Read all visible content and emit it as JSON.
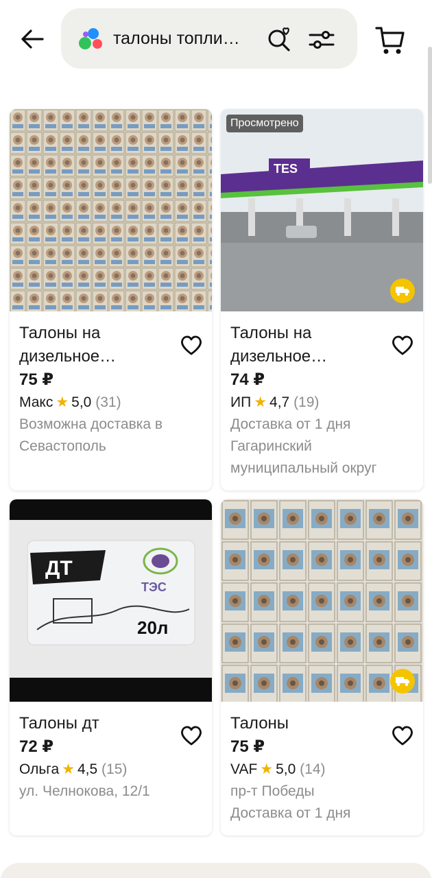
{
  "header": {
    "search_query": "талоны топли…",
    "icons": [
      "back-arrow-icon",
      "app-logo",
      "favorite-search-icon",
      "filters-icon",
      "cart-icon"
    ]
  },
  "colors": {
    "star": "#f2b200",
    "delivery_badge": "#f5c400",
    "muted_text": "#8c8c8c",
    "search_bg": "#efefec"
  },
  "cards": [
    {
      "title": "Талоны на дизельное…",
      "price": "75 ₽",
      "seller": "Макс",
      "rating": "5,0",
      "reviews": "(31)",
      "meta1": "Возможна доставка в Севастополь",
      "meta2": ""
    },
    {
      "badge": "Просмотрено",
      "title": "Талоны на дизельное…",
      "price": "74 ₽",
      "seller": "ИП",
      "rating": "4,7",
      "reviews": "(19)",
      "meta1": "Доставка от 1 дня",
      "meta2": "Гагаринский муниципальный округ",
      "photo_text": "TES"
    },
    {
      "title": "Талоны дт",
      "price": "72 ₽",
      "seller": "Ольга",
      "rating": "4,5",
      "reviews": "(15)",
      "meta1": "ул. Челнокова, 12/1",
      "meta2": "",
      "photo_text_1": "ДТ",
      "photo_text_2": "ТЭС",
      "photo_text_3": "20л"
    },
    {
      "title": "Талоны",
      "price": "75 ₽",
      "seller": "VAF",
      "rating": "5,0",
      "reviews": "(14)",
      "meta1": "пр-т Победы",
      "meta2": "Доставка от 1 дня"
    }
  ]
}
